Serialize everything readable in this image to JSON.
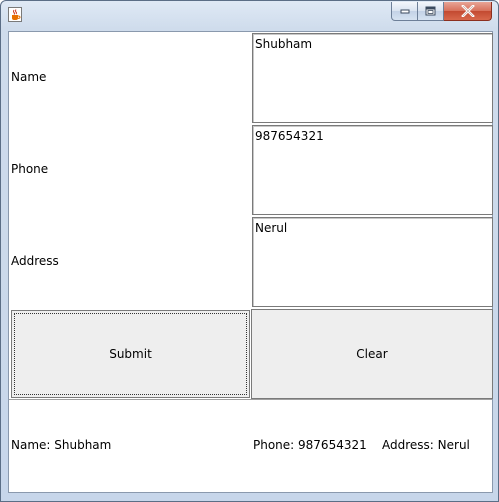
{
  "window": {
    "title": "",
    "icon": "java-cup-icon"
  },
  "form": {
    "name_label": "Name",
    "phone_label": "Phone",
    "address_label": "Address",
    "name_value": "Shubham",
    "phone_value": "987654321",
    "address_value": "Nerul"
  },
  "buttons": {
    "submit": "Submit",
    "clear": "Clear"
  },
  "result": {
    "name_text": "Name: Shubham",
    "phone_address_text": "Phone: 987654321    Address: Nerul"
  }
}
